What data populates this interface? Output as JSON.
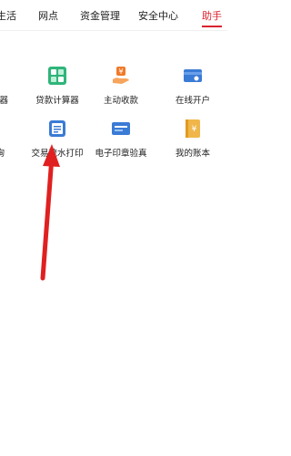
{
  "tabs": [
    {
      "label": "生活"
    },
    {
      "label": "网点"
    },
    {
      "label": "资金管理"
    },
    {
      "label": "安全中心"
    },
    {
      "label": "助手"
    }
  ],
  "grid": {
    "row1": [
      {
        "label": "算器",
        "icon": "calculator-icon"
      },
      {
        "label": "贷款计算器",
        "icon": "loan-calculator-icon"
      },
      {
        "label": "主动收款",
        "icon": "receive-payment-icon"
      },
      {
        "label": "在线开户",
        "icon": "online-account-card-icon"
      }
    ],
    "row2": [
      {
        "label": "询",
        "icon": "query-icon"
      },
      {
        "label": "交易流水打印",
        "icon": "transaction-print-icon"
      },
      {
        "label": "电子印章验真",
        "icon": "e-seal-verify-icon"
      },
      {
        "label": "我的账本",
        "icon": "ledger-icon"
      }
    ]
  },
  "colors": {
    "accent": "#d9232f",
    "arrow": "#e02020",
    "icon_green": "#2fb57a",
    "icon_orange": "#f07a2a",
    "icon_blue": "#3a7bd5",
    "icon_gold": "#f0b64a"
  }
}
